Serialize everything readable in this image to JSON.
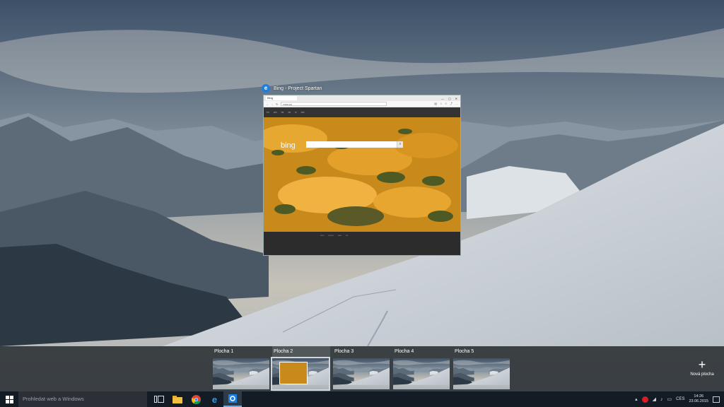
{
  "window": {
    "app_icon": "edge-spartan-icon",
    "title": "Bing - Project Spartan",
    "tab_label": "Bing",
    "url": "msn.cz"
  },
  "bing": {
    "logo_text": "bing"
  },
  "desktops": [
    {
      "label": "Plocha 1",
      "active": false
    },
    {
      "label": "Plocha 2",
      "active": true
    },
    {
      "label": "Plocha 3",
      "active": false
    },
    {
      "label": "Plocha 4",
      "active": false
    },
    {
      "label": "Plocha 5",
      "active": false
    }
  ],
  "new_desktop": {
    "plus": "+",
    "label": "Nová plocha"
  },
  "taskbar": {
    "search_placeholder": "Prohledat web a Windows",
    "pinned": [
      "task-view-icon",
      "file-explorer-icon",
      "chrome-icon",
      "internet-explorer-icon",
      "settings-icon"
    ],
    "language": "CES",
    "time": "14:26",
    "date": "23.06.2015"
  },
  "colors": {
    "taskbar_bg": "#131c24",
    "strip_bg": "#202428",
    "accent": "#1e7fe0"
  }
}
